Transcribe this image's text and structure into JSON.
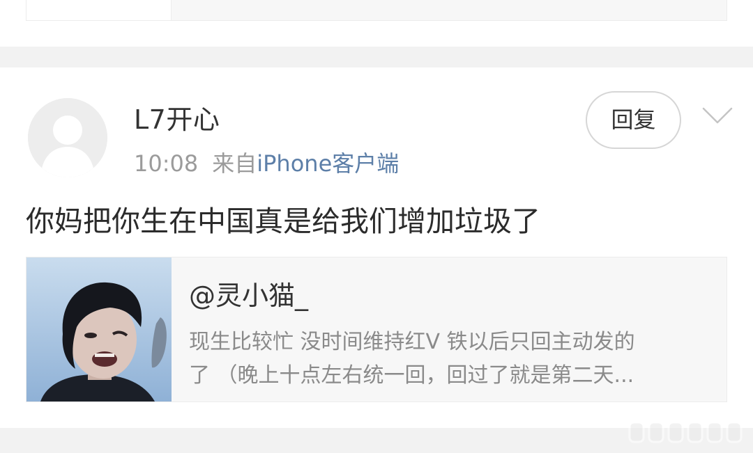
{
  "post": {
    "username": "L7开心",
    "time": "10:08",
    "source_label": "来自",
    "source_client": "iPhone客户端",
    "reply_label": "回复",
    "comment_text": "你妈把你生在中国真是给我们增加垃圾了"
  },
  "quoted": {
    "author": "@灵小猫_",
    "text_line1": "现生比较忙 没时间维持红V 铁以后只回主动发的",
    "text_line2": "了 （晚上十点左右统一回，回过了就是第二天..."
  },
  "icons": {
    "avatar": "default-avatar-icon",
    "more": "chevron-down-icon",
    "watermark": "watermark-logo"
  },
  "colors": {
    "background": "#ffffff",
    "separator": "#f2f2f2",
    "card": "#f7f7f7",
    "link": "#5d7fa8",
    "muted": "#9b9b9b"
  }
}
